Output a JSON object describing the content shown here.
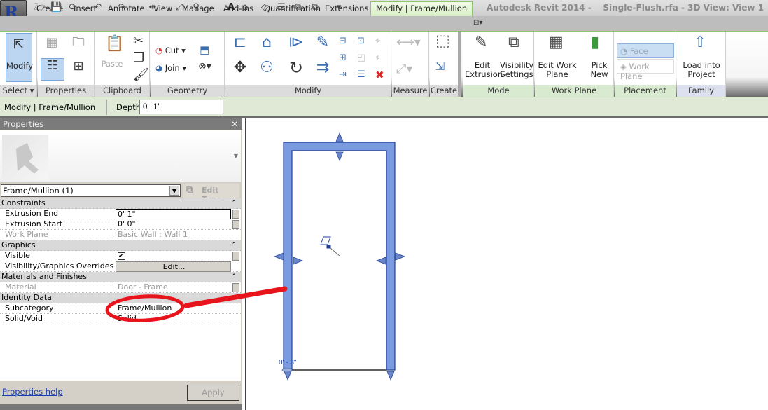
{
  "app": {
    "title": "Autodesk Revit 2014 -    Single-Flush.rfa - 3D View: View 1",
    "app_button": "R"
  },
  "qat": {
    "icons": [
      "open-icon",
      "save-icon",
      "sync-icon",
      "undo-icon",
      "redo-icon",
      "measure-icon",
      "dimension-icon",
      "tag-icon",
      "text-icon",
      "3d-view-icon",
      "section-icon",
      "thin-lines-icon",
      "close-hidden-icon",
      "switch-windows-icon",
      "customize-icon"
    ]
  },
  "tabs": [
    "Create",
    "Insert",
    "Annotate",
    "View",
    "Manage",
    "Add-Ins",
    "Quantification",
    "Extensions",
    "Modify | Frame/Mullion"
  ],
  "ribbon": {
    "select": {
      "modify": "Modify",
      "label": "Select ▾"
    },
    "properties": {
      "label": "Properties"
    },
    "clipboard": {
      "paste": "Paste",
      "label": "Clipboard"
    },
    "geometry": {
      "cut": "Cut",
      "join": "Join",
      "label": "Geometry"
    },
    "modify": {
      "label": "Modify"
    },
    "measure": {
      "label": "Measure"
    },
    "create": {
      "label": "Create"
    },
    "mode": {
      "edit_extrusion": "Edit Extrusion",
      "visibility_settings": "Visibility Settings",
      "label": "Mode"
    },
    "work_plane": {
      "edit_work_plane": "Edit Work Plane",
      "pick_new": "Pick New",
      "label": "Work Plane"
    },
    "placement": {
      "face": "Face",
      "work_plane": "Work Plane",
      "label": "Placement"
    },
    "family_editor": {
      "load_into_project": "Load into Project",
      "label": "Family Editor"
    }
  },
  "options_bar": {
    "context": "Modify | Frame/Mullion",
    "depth_label": "Depth",
    "depth_value": "0'  1\""
  },
  "properties": {
    "title": "Properties",
    "type_selector": "Frame/Mullion (1)",
    "edit_type": "Edit Type",
    "groups": [
      {
        "name": "Constraints",
        "rows": [
          {
            "key": "Extrusion End",
            "value": "0'  1\""
          },
          {
            "key": "Extrusion Start",
            "value": "0'  0\""
          },
          {
            "key": "Work Plane",
            "value": "Basic Wall : Wall 1",
            "disabled": true
          }
        ]
      },
      {
        "name": "Graphics",
        "rows": [
          {
            "key": "Visible",
            "value": "✔"
          },
          {
            "key": "Visibility/Graphics Overrides",
            "value": "Edit..."
          }
        ]
      },
      {
        "name": "Materials and Finishes",
        "rows": [
          {
            "key": "Material",
            "value": "Door - Frame",
            "disabled": true
          }
        ]
      },
      {
        "name": "Identity Data",
        "rows": [
          {
            "key": "Subcategory",
            "value": "Frame/Mullion"
          },
          {
            "key": "Solid/Void",
            "value": "Solid"
          }
        ]
      }
    ],
    "help_link": "Properties help",
    "apply": "Apply"
  },
  "viewport": {
    "dimension_label": "0' - 3\"",
    "frame_color": "#7b9be0",
    "annotation_color": "#e8141c"
  }
}
